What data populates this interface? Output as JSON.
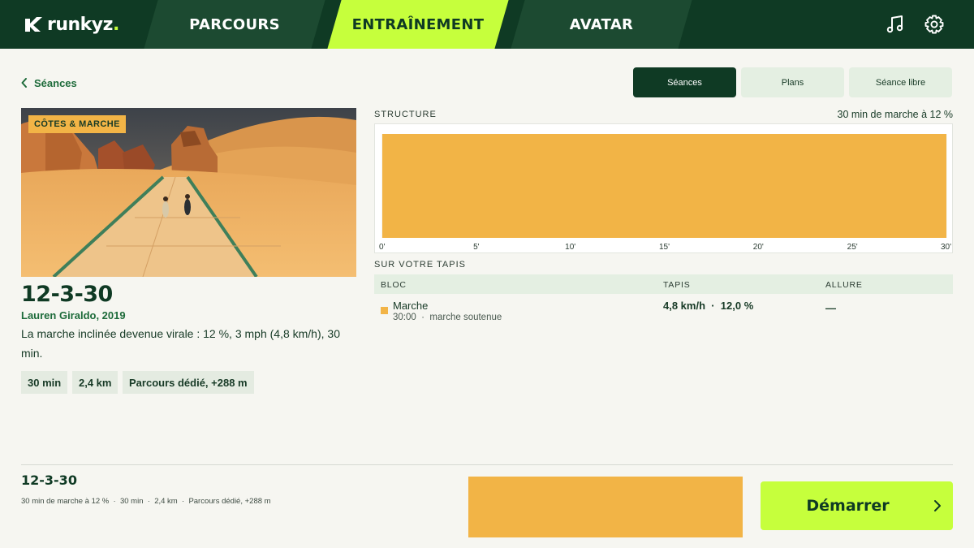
{
  "brand": {
    "name": "runkyz",
    "dot": ".",
    "accent": "#c6ff3c",
    "dark": "#0f3a24"
  },
  "nav": {
    "tabs": [
      {
        "label": "PARCOURS",
        "active": false
      },
      {
        "label": "ENTRAÎNEMENT",
        "active": true
      },
      {
        "label": "AVATAR",
        "active": false
      }
    ],
    "icons": [
      "music-icon",
      "gear-icon"
    ]
  },
  "back": {
    "label": "Séances"
  },
  "segments": [
    {
      "label": "Séances",
      "active": true
    },
    {
      "label": "Plans",
      "active": false
    },
    {
      "label": "Séance libre",
      "active": false
    }
  ],
  "workout": {
    "tag": "CÔTES & MARCHE",
    "title": "12-3-30",
    "author": "Lauren Giraldo, 2019",
    "description": "La marche inclinée devenue virale : 12 %, 3 mph (4,8 km/h), 30 min.",
    "chips": [
      "30 min",
      "2,4 km",
      "Parcours dédié, +288 m"
    ]
  },
  "structure": {
    "label": "STRUCTURE",
    "summary": "30 min de marche à 12 %"
  },
  "chart_data": {
    "type": "bar",
    "x_ticks": [
      "0'",
      "5'",
      "10'",
      "15'",
      "20'",
      "25'",
      "30'"
    ],
    "xlim": [
      0,
      30
    ],
    "segments": [
      {
        "start": 0,
        "end": 30,
        "intensity": 1,
        "color": "#f2b446"
      }
    ],
    "grid": true
  },
  "tapis": {
    "label": "SUR VOTRE TAPIS",
    "columns": [
      "BLOC",
      "TAPIS",
      "ALLURE"
    ],
    "rows": [
      {
        "name": "Marche",
        "duration": "30:00",
        "sep": "·",
        "note": "marche soutenue",
        "tapis": "4,8 km/h  ·  12,0 %",
        "allure": "—",
        "color": "#f2b446"
      }
    ]
  },
  "footer": {
    "title": "12-3-30",
    "meta": "30 min de marche à 12 %  ·  30 min  ·  2,4 km  ·  Parcours dédié, +288 m",
    "start_label": "Démarrer"
  }
}
